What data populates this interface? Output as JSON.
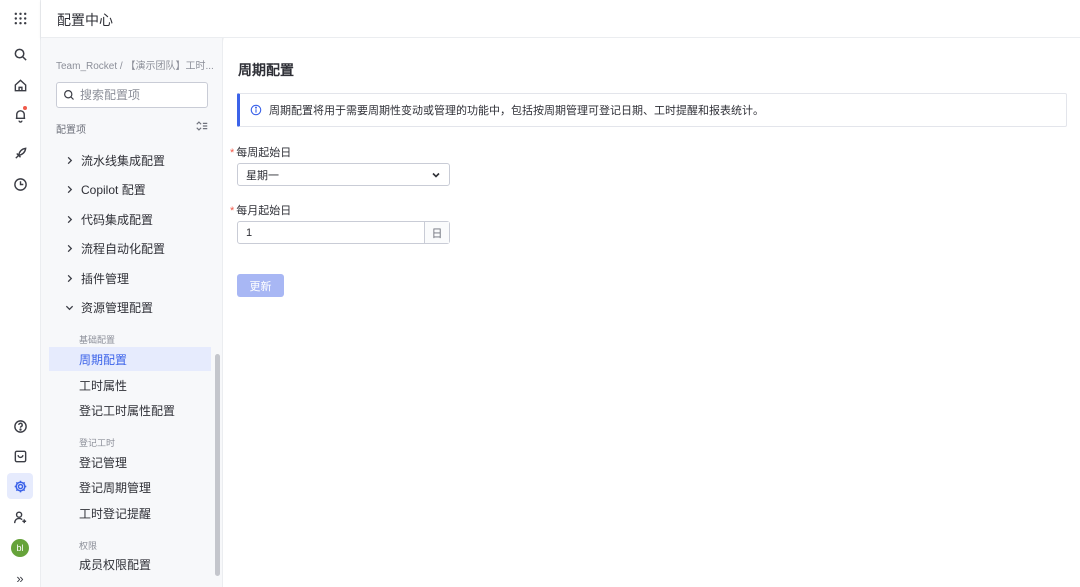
{
  "header": {
    "title": "配置中心"
  },
  "rail": {
    "top_icons": [
      "grid-icon",
      "search-icon",
      "home-icon",
      "bell-icon",
      "rocket-icon",
      "clock-icon"
    ],
    "bottom_icons": [
      "help-icon",
      "box-icon",
      "settings-icon",
      "add-user-icon"
    ],
    "avatar_text": "bl",
    "expand_glyph": "»",
    "accent": "#3c63e9"
  },
  "sidebar": {
    "breadcrumb": "Team_Rocket / 【演示团队】工时...",
    "search_placeholder": "搜索配置项",
    "section_label": "配置项",
    "items": [
      {
        "label": "流水线集成配置",
        "expanded": false
      },
      {
        "label": "Copilot 配置",
        "expanded": false
      },
      {
        "label": "代码集成配置",
        "expanded": false
      },
      {
        "label": "流程自动化配置",
        "expanded": false
      },
      {
        "label": "插件管理",
        "expanded": false
      },
      {
        "label": "资源管理配置",
        "expanded": true
      }
    ],
    "groups": [
      {
        "label": "基础配置",
        "items": [
          "周期配置",
          "工时属性",
          "登记工时属性配置"
        ]
      },
      {
        "label": "登记工时",
        "items": [
          "登记管理",
          "登记周期管理",
          "工时登记提醒"
        ]
      },
      {
        "label": "权限",
        "items": [
          "成员权限配置"
        ]
      }
    ],
    "active_item": "周期配置"
  },
  "main": {
    "title": "周期配置",
    "info": "周期配置将用于需要周期性变动或管理的功能中，包括按周期管理可登记日期、工时提醒和报表统计。",
    "week_start": {
      "label": "每周起始日",
      "required_mark": "*",
      "value": "星期一"
    },
    "month_start": {
      "label": "每月起始日",
      "required_mark": "*",
      "value": "1",
      "unit": "日"
    },
    "update_button": "更新"
  }
}
